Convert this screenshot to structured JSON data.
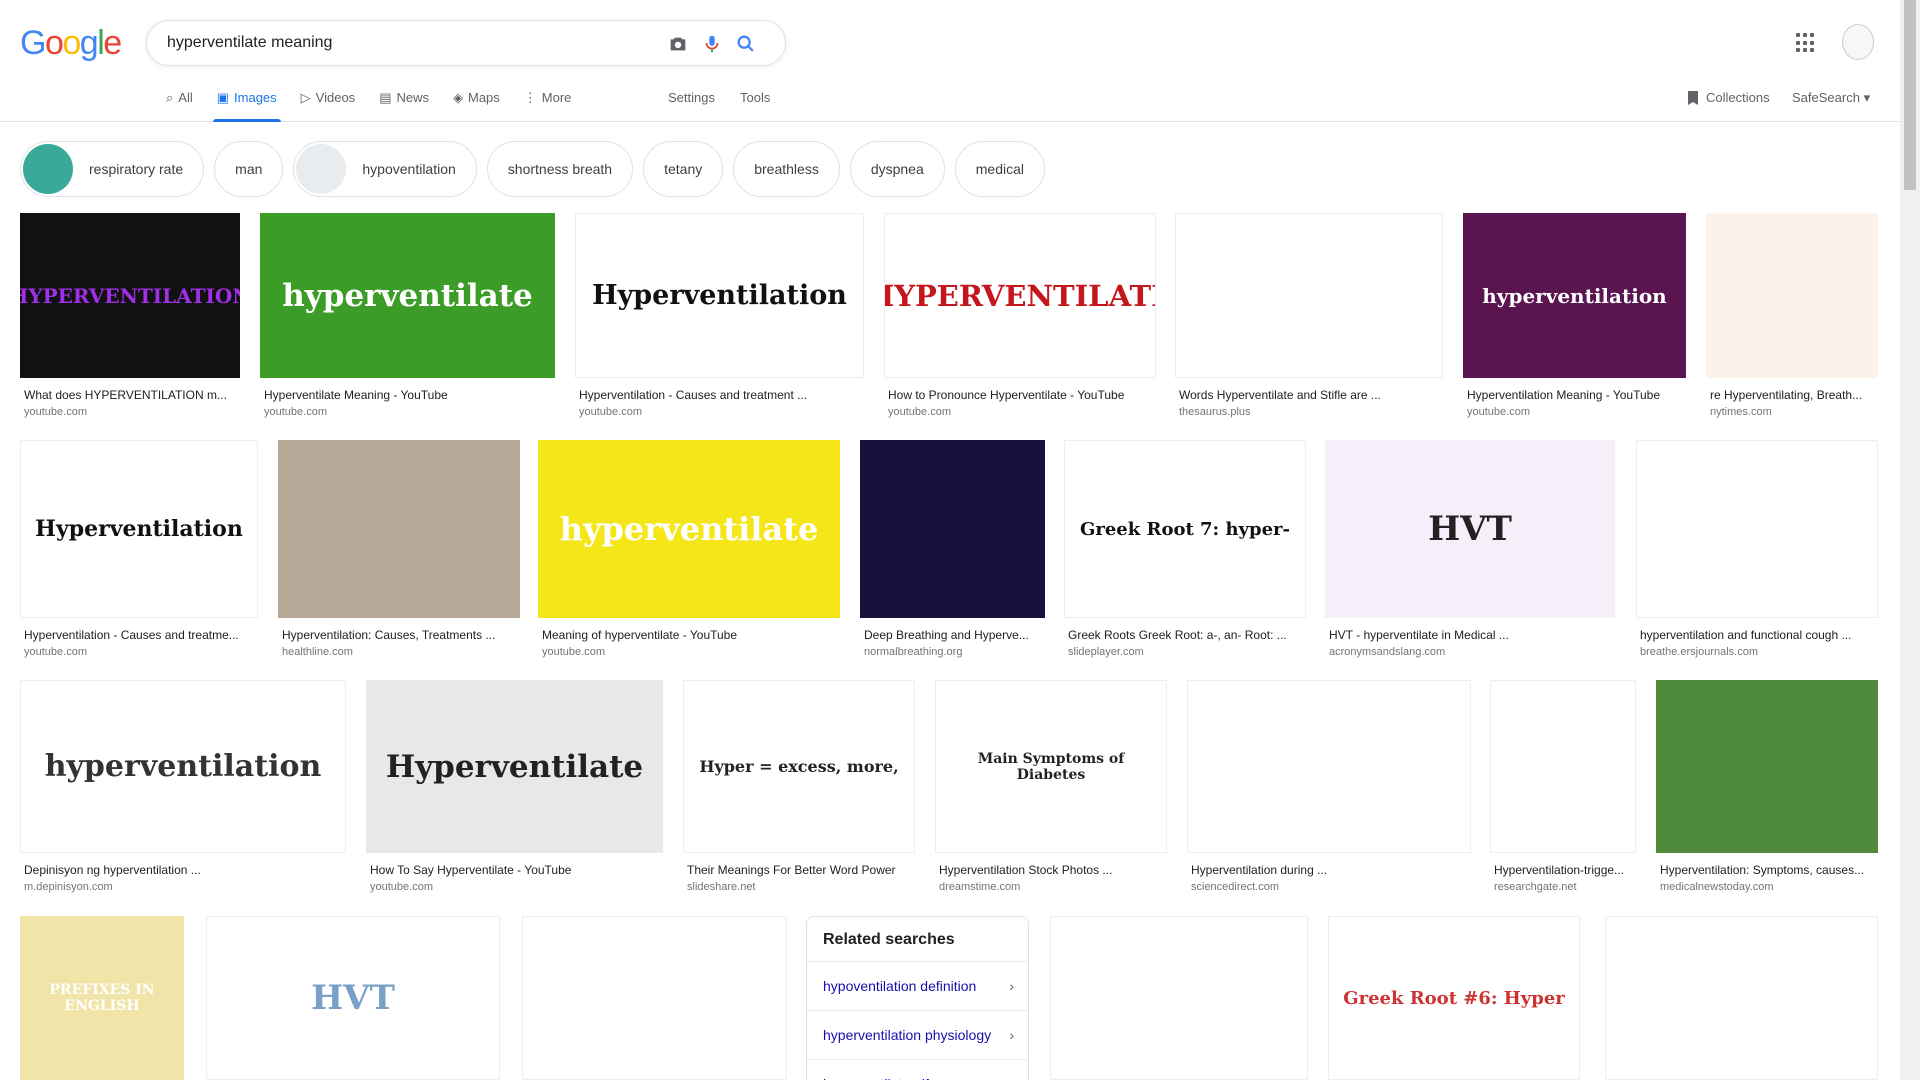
{
  "header": {
    "logo_letters": [
      {
        "ch": "G",
        "color": "#4285f4"
      },
      {
        "ch": "o",
        "color": "#ea4335"
      },
      {
        "ch": "o",
        "color": "#fbbc05"
      },
      {
        "ch": "g",
        "color": "#4285f4"
      },
      {
        "ch": "l",
        "color": "#34a853"
      },
      {
        "ch": "e",
        "color": "#ea4335"
      }
    ],
    "search_query": "hyperventilate meaning"
  },
  "tabs": [
    {
      "label": "All",
      "icon": "search-icon"
    },
    {
      "label": "Images",
      "icon": "image-icon",
      "active": true
    },
    {
      "label": "Videos",
      "icon": "video-icon"
    },
    {
      "label": "News",
      "icon": "news-icon"
    },
    {
      "label": "Maps",
      "icon": "map-icon"
    },
    {
      "label": "More",
      "icon": "more-icon"
    }
  ],
  "tools": {
    "settings": "Settings",
    "tools": "Tools",
    "collections": "Collections",
    "safesearch": "SafeSearch"
  },
  "chips": [
    {
      "label": "respiratory rate",
      "thumb": true,
      "color": "#3aa99a"
    },
    {
      "label": "man"
    },
    {
      "label": "hypoventilation",
      "thumb": true,
      "color": "#e9ecef"
    },
    {
      "label": "shortness breath"
    },
    {
      "label": "tetany"
    },
    {
      "label": "breathless"
    },
    {
      "label": "dyspnea"
    },
    {
      "label": "medical"
    }
  ],
  "results": [
    {
      "title": "What does HYPERVENTILATION m...",
      "source": "youtube.com",
      "thumb_text": "HYPERVENTILATION",
      "bg": "#111",
      "fg": "#a12ee8"
    },
    {
      "title": "Hyperventilate Meaning - YouTube",
      "source": "youtube.com",
      "thumb_text": "hyperventilate",
      "bg": "#3b9d27",
      "fg": "#fff"
    },
    {
      "title": "Hyperventilation - Causes and treatment ...",
      "source": "youtube.com",
      "thumb_text": "Hyperventilation",
      "bg": "#fff",
      "fg": "#111"
    },
    {
      "title": "How to Pronounce Hyperventilate - YouTube",
      "source": "youtube.com",
      "thumb_text": "HYPERVENTILATE",
      "bg": "#fff",
      "fg": "#c4161c"
    },
    {
      "title": "Words Hyperventilate and Stifle are ...",
      "source": "thesaurus.plus",
      "thumb_text": "",
      "bg": "#fff",
      "fg": "#555"
    },
    {
      "title": "Hyperventilation Meaning - YouTube",
      "source": "youtube.com",
      "thumb_text": "hyperventilation",
      "bg": "#5a1450",
      "fg": "#fff"
    },
    {
      "title": "re Hyperventilating, Breath...",
      "source": "nytimes.com",
      "thumb_text": "",
      "bg": "#fbf3ea",
      "fg": "#333"
    },
    {
      "title": "Hyperventilation - Causes and treatme...",
      "source": "youtube.com",
      "thumb_text": "Hyperventilation",
      "bg": "#fff",
      "fg": "#111"
    },
    {
      "title": "Hyperventilation: Causes, Treatments ...",
      "source": "healthline.com",
      "thumb_text": "",
      "bg": "#b8a898",
      "fg": "#fff"
    },
    {
      "title": "Meaning of hyperventilate - YouTube",
      "source": "youtube.com",
      "thumb_text": "hyperventilate",
      "bg": "#f5e61a",
      "fg": "#fff"
    },
    {
      "title": "Deep Breathing and Hyperve...",
      "source": "normalbreathing.org",
      "thumb_text": "",
      "bg": "#1a1040",
      "fg": "#fff"
    },
    {
      "title": "Greek Roots Greek Root: a-, an- Root: ...",
      "source": "slideplayer.com",
      "thumb_text": "Greek Root 7: hyper-",
      "bg": "#fff",
      "fg": "#111"
    },
    {
      "title": "HVT - hyperventilate in Medical ...",
      "source": "acronymsandslang.com",
      "thumb_text": "HVT",
      "bg": "#f6eef8",
      "fg": "#222"
    },
    {
      "title": "hyperventilation and functional cough ...",
      "source": "breathe.ersjournals.com",
      "thumb_text": "",
      "bg": "#fff",
      "fg": "#333"
    },
    {
      "title": "Depinisyon ng hyperventilation ...",
      "source": "m.depinisyon.com",
      "thumb_text": "hyperventilation",
      "bg": "#fff",
      "fg": "#333"
    },
    {
      "title": "How To Say Hyperventilate - YouTube",
      "source": "youtube.com",
      "thumb_text": "Hyperventilate",
      "bg": "#e8e8e6",
      "fg": "#222"
    },
    {
      "title": "Their Meanings For Better Word Power",
      "source": "slideshare.net",
      "thumb_text": "Hyper = excess, more,",
      "bg": "#fff",
      "fg": "#222"
    },
    {
      "title": "Hyperventilation Stock Photos ...",
      "source": "dreamstime.com",
      "thumb_text": "Main Symptoms of Diabetes",
      "bg": "#fff",
      "fg": "#222"
    },
    {
      "title": "Hyperventilation during ...",
      "source": "sciencedirect.com",
      "thumb_text": "",
      "bg": "#fff",
      "fg": "#222"
    },
    {
      "title": "Hyperventilation-trigge...",
      "source": "researchgate.net",
      "thumb_text": "",
      "bg": "#fff",
      "fg": "#222"
    },
    {
      "title": "Hyperventilation: Symptoms, causes...",
      "source": "medicalnewstoday.com",
      "thumb_text": "",
      "bg": "#4f8a3a",
      "fg": "#fff"
    },
    {
      "title": "",
      "source": "",
      "thumb_text": "PREFIXES IN ENGLISH",
      "bg": "#f0e4a8",
      "fg": "#fff"
    },
    {
      "title": "",
      "source": "",
      "thumb_text": "HVT",
      "bg": "#fff",
      "fg": "#7aa0c8"
    },
    {
      "title": "",
      "source": "",
      "thumb_text": "",
      "bg": "#fff",
      "fg": "#333"
    },
    {
      "title": "",
      "source": "",
      "thumb_text": "",
      "bg": "#fff",
      "fg": "#333"
    },
    {
      "title": "",
      "source": "",
      "thumb_text": "Greek Root #6: Hyper",
      "bg": "#fff",
      "fg": "#c33"
    },
    {
      "title": "",
      "source": "",
      "thumb_text": "",
      "bg": "#fff",
      "fg": "#333"
    }
  ],
  "related": {
    "heading": "Related searches",
    "items": [
      "hypoventilation definition",
      "hyperventilation physiology",
      "hyperventilate gif"
    ]
  }
}
